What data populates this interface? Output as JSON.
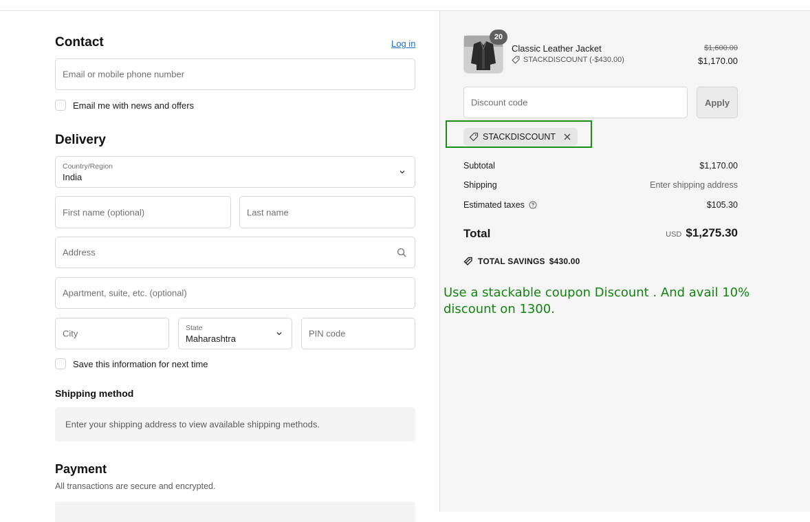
{
  "contact": {
    "heading": "Contact",
    "login_link": "Log in",
    "email_placeholder": "Email or mobile phone number",
    "news_checkbox_label": "Email me with news and offers"
  },
  "delivery": {
    "heading": "Delivery",
    "country_label": "Country/Region",
    "country_value": "India",
    "first_name_placeholder": "First name (optional)",
    "last_name_placeholder": "Last name",
    "address_placeholder": "Address",
    "apartment_placeholder": "Apartment, suite, etc. (optional)",
    "city_placeholder": "City",
    "state_label": "State",
    "state_value": "Maharashtra",
    "pin_placeholder": "PIN code",
    "save_checkbox_label": "Save this information for next time"
  },
  "shipping_method": {
    "heading": "Shipping method",
    "message": "Enter your shipping address to view available shipping methods."
  },
  "payment": {
    "heading": "Payment",
    "subtext": "All transactions are secure and encrypted."
  },
  "summary": {
    "product": {
      "quantity_badge": "20",
      "name": "Classic Leather Jacket",
      "discount_line": "STACKDISCOUNT (-$430.00)",
      "original_price": "$1,600.00",
      "price": "$1,170.00"
    },
    "discount_placeholder": "Discount code",
    "apply_label": "Apply",
    "applied_code": "STACKDISCOUNT",
    "subtotal_label": "Subtotal",
    "subtotal_value": "$1,170.00",
    "shipping_label": "Shipping",
    "shipping_value": "Enter shipping address",
    "taxes_label": "Estimated taxes",
    "taxes_value": "$105.30",
    "total_label": "Total",
    "total_currency": "USD",
    "total_value": "$1,275.30",
    "savings_label": "TOTAL SAVINGS",
    "savings_value": "$430.00"
  },
  "annotation": {
    "text": "Use a stackable coupon Discount . And avail 10% discount on 1300."
  },
  "colors": {
    "annotation_green": "#12840f",
    "highlight_border": "#188d18",
    "link_blue": "#1f6fd1"
  }
}
